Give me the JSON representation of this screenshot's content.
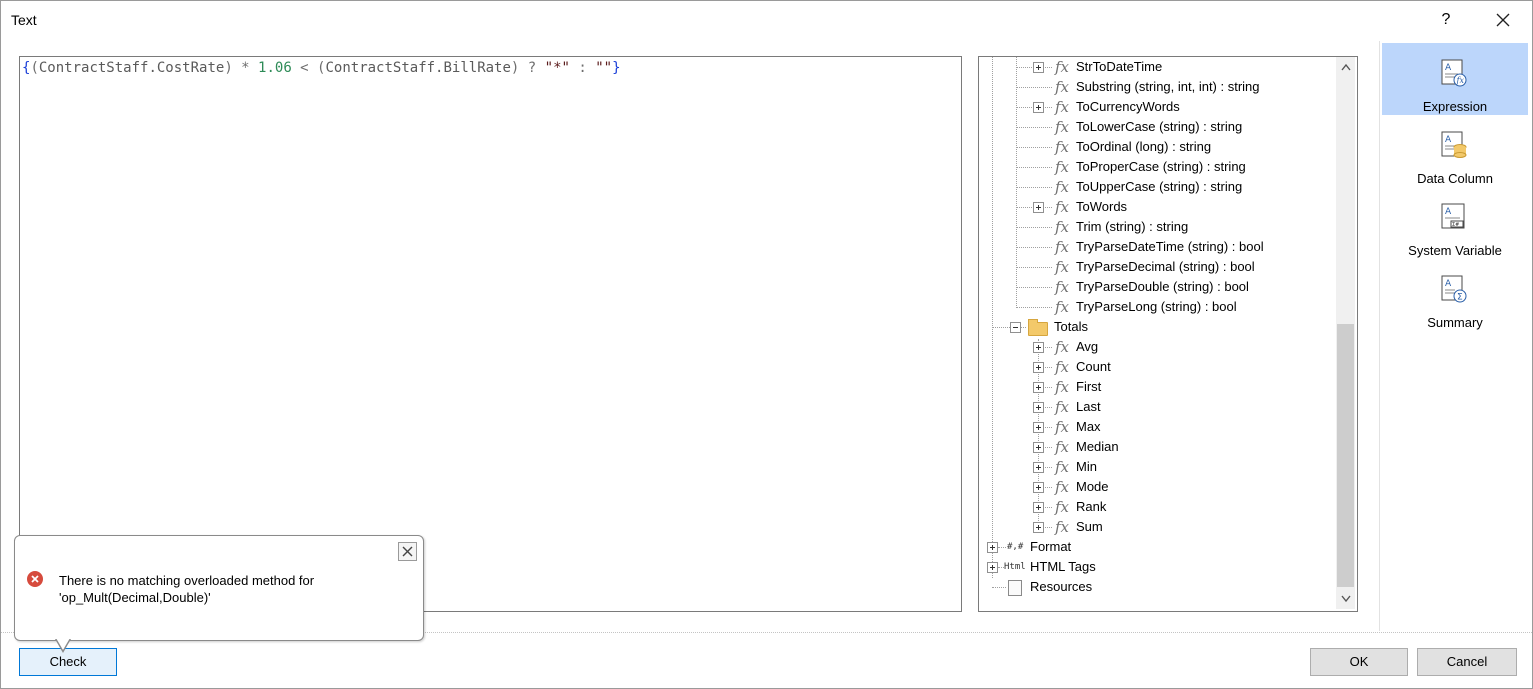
{
  "window": {
    "title": "Text",
    "help_label": "?"
  },
  "editor": {
    "tokens": [
      {
        "t": "{",
        "c": "t-brace"
      },
      {
        "t": "(",
        "c": "t-paren"
      },
      {
        "t": "ContractStaff.CostRate",
        "c": "t-ident"
      },
      {
        "t": ") ",
        "c": "t-paren"
      },
      {
        "t": "* ",
        "c": "t-op"
      },
      {
        "t": "1.06",
        "c": "t-num"
      },
      {
        "t": " < ",
        "c": "t-op"
      },
      {
        "t": "(",
        "c": "t-paren"
      },
      {
        "t": "ContractStaff.BillRate",
        "c": "t-ident"
      },
      {
        "t": ") ",
        "c": "t-paren"
      },
      {
        "t": "? ",
        "c": "t-op"
      },
      {
        "t": "\"*\"",
        "c": "t-str"
      },
      {
        "t": " : ",
        "c": "t-op"
      },
      {
        "t": "\"\"",
        "c": "t-str"
      },
      {
        "t": "}",
        "c": "t-brace"
      }
    ]
  },
  "tree": {
    "functions": [
      {
        "label": "StrToDateTime",
        "expandable": true
      },
      {
        "label": "Substring (string, int, int) : string",
        "expandable": false
      },
      {
        "label": "ToCurrencyWords",
        "expandable": true
      },
      {
        "label": "ToLowerCase (string) : string",
        "expandable": false
      },
      {
        "label": "ToOrdinal (long) : string",
        "expandable": false
      },
      {
        "label": "ToProperCase (string) : string",
        "expandable": false
      },
      {
        "label": "ToUpperCase (string) : string",
        "expandable": false
      },
      {
        "label": "ToWords",
        "expandable": true
      },
      {
        "label": "Trim (string) : string",
        "expandable": false
      },
      {
        "label": "TryParseDateTime (string) : bool",
        "expandable": false
      },
      {
        "label": "TryParseDecimal (string) : bool",
        "expandable": false
      },
      {
        "label": "TryParseDouble (string) : bool",
        "expandable": false
      },
      {
        "label": "TryParseLong (string) : bool",
        "expandable": false
      }
    ],
    "totals_label": "Totals",
    "totals": [
      "Avg",
      "Count",
      "First",
      "Last",
      "Max",
      "Median",
      "Min",
      "Mode",
      "Rank",
      "Sum"
    ],
    "format_label": "Format",
    "format_icon_text": "#,#",
    "html_tags_label": "HTML Tags",
    "html_icon_text": "Html",
    "resources_label": "Resources"
  },
  "side": {
    "expression_label": "Expression",
    "data_column_label": "Data Column",
    "system_variable_label": "System Variable",
    "summary_label": "Summary"
  },
  "tooltip": {
    "message": "There is no matching overloaded method for 'op_Mult(Decimal,Double)'"
  },
  "buttons": {
    "check_label": "Check",
    "ok_label": "OK",
    "cancel_label": "Cancel"
  },
  "colors": {
    "accent": "#0078d7",
    "selected_bg": "#bcd6fb",
    "error": "#d64b3d"
  }
}
